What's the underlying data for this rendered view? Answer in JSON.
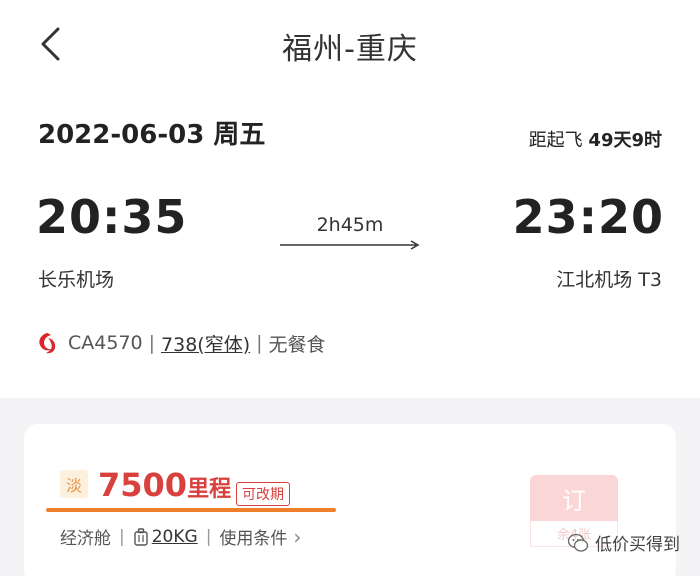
{
  "header": {
    "title": "福州-重庆"
  },
  "flight": {
    "date": "2022-06-03 周五",
    "countdown_prefix": "距起飞",
    "countdown_value": "49天9时",
    "departure_time": "20:35",
    "arrival_time": "23:20",
    "duration": "2h45m",
    "departure_airport": "长乐机场",
    "arrival_airport": "江北机场 T3",
    "flight_no": "CA4570",
    "aircraft": "738(窄体)",
    "meal": "无餐食",
    "separator": "|"
  },
  "fare": {
    "tag": "淡",
    "miles_value": "7500",
    "miles_unit": "里程",
    "changeable": "可改期",
    "cabin": "经济舱",
    "baggage": "20KG",
    "conditions": "使用条件",
    "conditions_arrow": "›",
    "book_label": "订",
    "book_sub": "余4张"
  },
  "watermark": {
    "text": "低价买得到"
  },
  "colors": {
    "accent_red": "#d8413e",
    "highlight_orange": "#f07f2c",
    "book_button_bg": "#fbd6d6"
  },
  "icons": {
    "back": "chevron-left-icon",
    "airline": "air-china-logo-icon",
    "baggage": "luggage-icon",
    "watermark": "wechat-icon"
  }
}
